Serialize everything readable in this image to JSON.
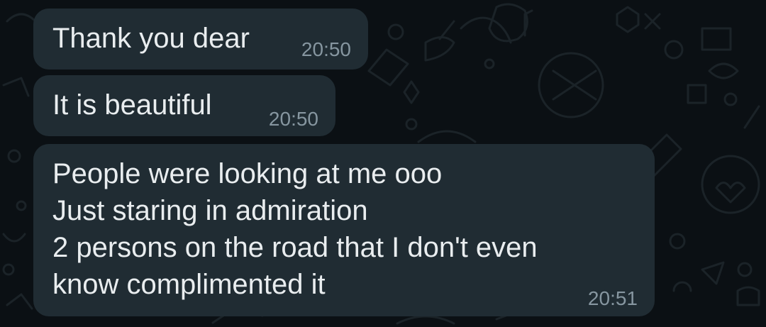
{
  "messages": [
    {
      "text": "Thank you dear",
      "time": "20:50"
    },
    {
      "text": "It is beautiful",
      "time": "20:50"
    },
    {
      "text": "People were looking at me ooo\nJust staring in admiration\n2 persons on the road that I don't even\nknow complimented it",
      "time": "20:51"
    }
  ],
  "colors": {
    "background": "#0b1014",
    "bubble": "#202c33",
    "text": "#e9edef",
    "timestamp": "#8696a0",
    "wallpaper_doodle": "#1b2328"
  }
}
